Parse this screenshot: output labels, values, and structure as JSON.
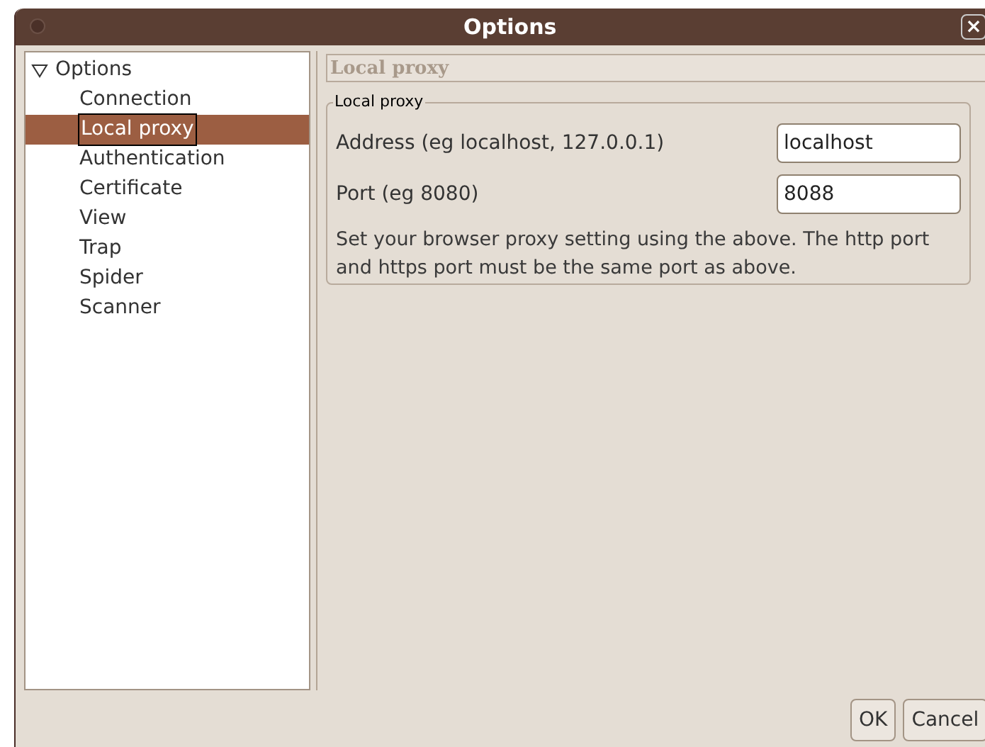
{
  "window": {
    "title": "Options",
    "close": "×"
  },
  "tree": {
    "label": "Options",
    "expanded": true,
    "children": [
      {
        "label": "Connection",
        "selected": false
      },
      {
        "label": "Local proxy",
        "selected": true
      },
      {
        "label": "Authentication",
        "selected": false
      },
      {
        "label": "Certificate",
        "selected": false
      },
      {
        "label": "View",
        "selected": false
      },
      {
        "label": "Trap",
        "selected": false
      },
      {
        "label": "Spider",
        "selected": false
      },
      {
        "label": "Scanner",
        "selected": false
      }
    ]
  },
  "panel": {
    "header": "Local proxy",
    "group": "Local proxy",
    "fields": [
      {
        "label": "Address (eg localhost, 127.0.0.1)",
        "value": "localhost"
      },
      {
        "label": "Port (eg 8080)",
        "value": "8088"
      }
    ],
    "note": "Set your browser proxy setting using the above. The http port and https port must be the same port as above."
  },
  "buttons": [
    "OK",
    "Cancel"
  ]
}
